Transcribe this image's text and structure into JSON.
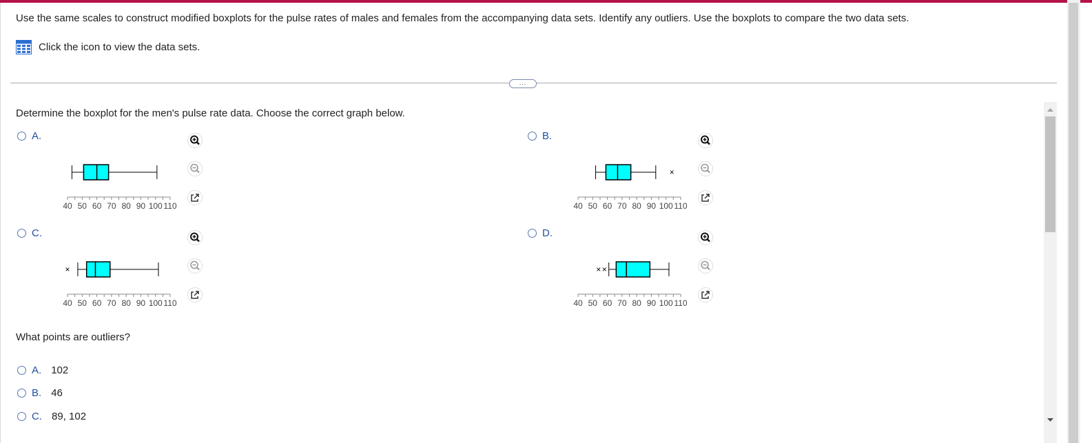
{
  "question": {
    "text": "Use the same scales to construct modified boxplots for the pulse rates of males and females from the accompanying data sets. Identify any outliers. Use the boxplots to compare the two data sets.",
    "dataset_link": "Click the icon to view the data sets.",
    "dataset_icon": "table-icon"
  },
  "more_button": "...",
  "part1": {
    "prompt": "Determine the boxplot for the men's pulse rate data. Choose the correct graph below.",
    "axis_ticks": [
      "40",
      "50",
      "60",
      "70",
      "80",
      "90",
      "100",
      "110"
    ],
    "options": [
      {
        "letter": "A.",
        "whisker_low": 43,
        "q1": 51,
        "median": 60,
        "q3": 68,
        "whisker_high": 101,
        "outliers": []
      },
      {
        "letter": "B.",
        "whisker_low": 52,
        "q1": 59,
        "median": 67,
        "q3": 76,
        "whisker_high": 93,
        "outliers": [
          104
        ]
      },
      {
        "letter": "C.",
        "whisker_low": 47,
        "q1": 53,
        "median": 59,
        "q3": 69,
        "whisker_high": 102,
        "outliers": [
          40
        ]
      },
      {
        "letter": "D.",
        "whisker_low": 61,
        "q1": 66,
        "median": 73,
        "q3": 89,
        "whisker_high": 102,
        "outliers": [
          54,
          58
        ]
      }
    ],
    "icons": [
      "zoom-in-icon",
      "zoom-out-icon",
      "popout-icon"
    ]
  },
  "part2": {
    "prompt": "What points are outliers?",
    "options": [
      {
        "letter": "A.",
        "text": "102"
      },
      {
        "letter": "B.",
        "text": "46"
      },
      {
        "letter": "C.",
        "text": "89, 102"
      }
    ]
  },
  "colors": {
    "accent": "#b4124a",
    "box_fill": "#00ffff",
    "link": "#2050a0"
  }
}
